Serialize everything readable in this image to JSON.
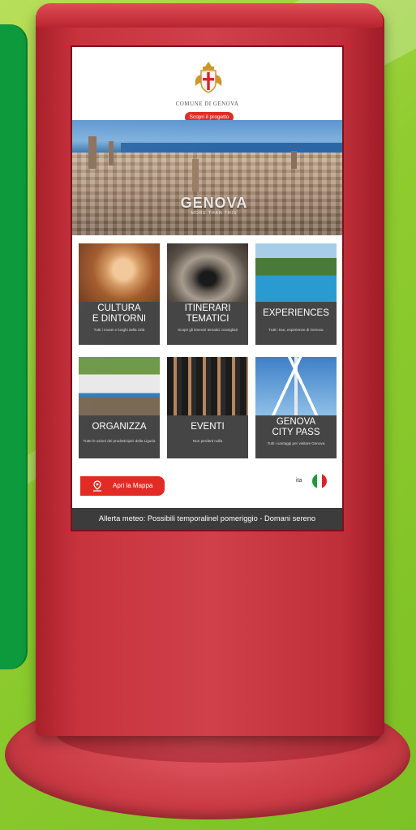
{
  "header": {
    "comune": "COMUNE DI GENOVA",
    "project_button": "Scopri il progetto"
  },
  "hero": {
    "logo_text": "GENOVA",
    "logo_sub": "MORE THAN THIS"
  },
  "tiles": [
    {
      "title_line1": "CULTURA",
      "title_line2": "E DINTORNI",
      "description": "Tutti i musei e luoghi della città"
    },
    {
      "title_line1": "ITINERARI",
      "title_line2": "TEMATICI",
      "description": "Scopri gli itinerari tematici consigliati"
    },
    {
      "title_line1": "EXPERIENCES",
      "title_line2": "",
      "description": "Tutti i tour, esperienze di Genova"
    },
    {
      "title_line1": "ORGANIZZA",
      "title_line2": "",
      "description": "Tutte le azioni dei prodotti tipici della Liguria"
    },
    {
      "title_line1": "EVENTI",
      "title_line2": "",
      "description": "Non perderti nulla"
    },
    {
      "title_line1": "GENOVA",
      "title_line2": "CITY PASS",
      "description": "Tutti i vantaggi per visitare Genova"
    }
  ],
  "footer": {
    "map_button": "Apri la Mappa",
    "language": "ita",
    "alert": "Allerta meteo: Possibili temporalinel pomeriggio - Domani sereno"
  },
  "colors": {
    "kiosk_red": "#c7333d",
    "accent_red": "#e22b24",
    "tile_bg": "#454545",
    "alert_bg": "#3c3c3c"
  },
  "icons": [
    "genova-crest-icon",
    "map-pin-icon",
    "italian-flag-icon"
  ]
}
